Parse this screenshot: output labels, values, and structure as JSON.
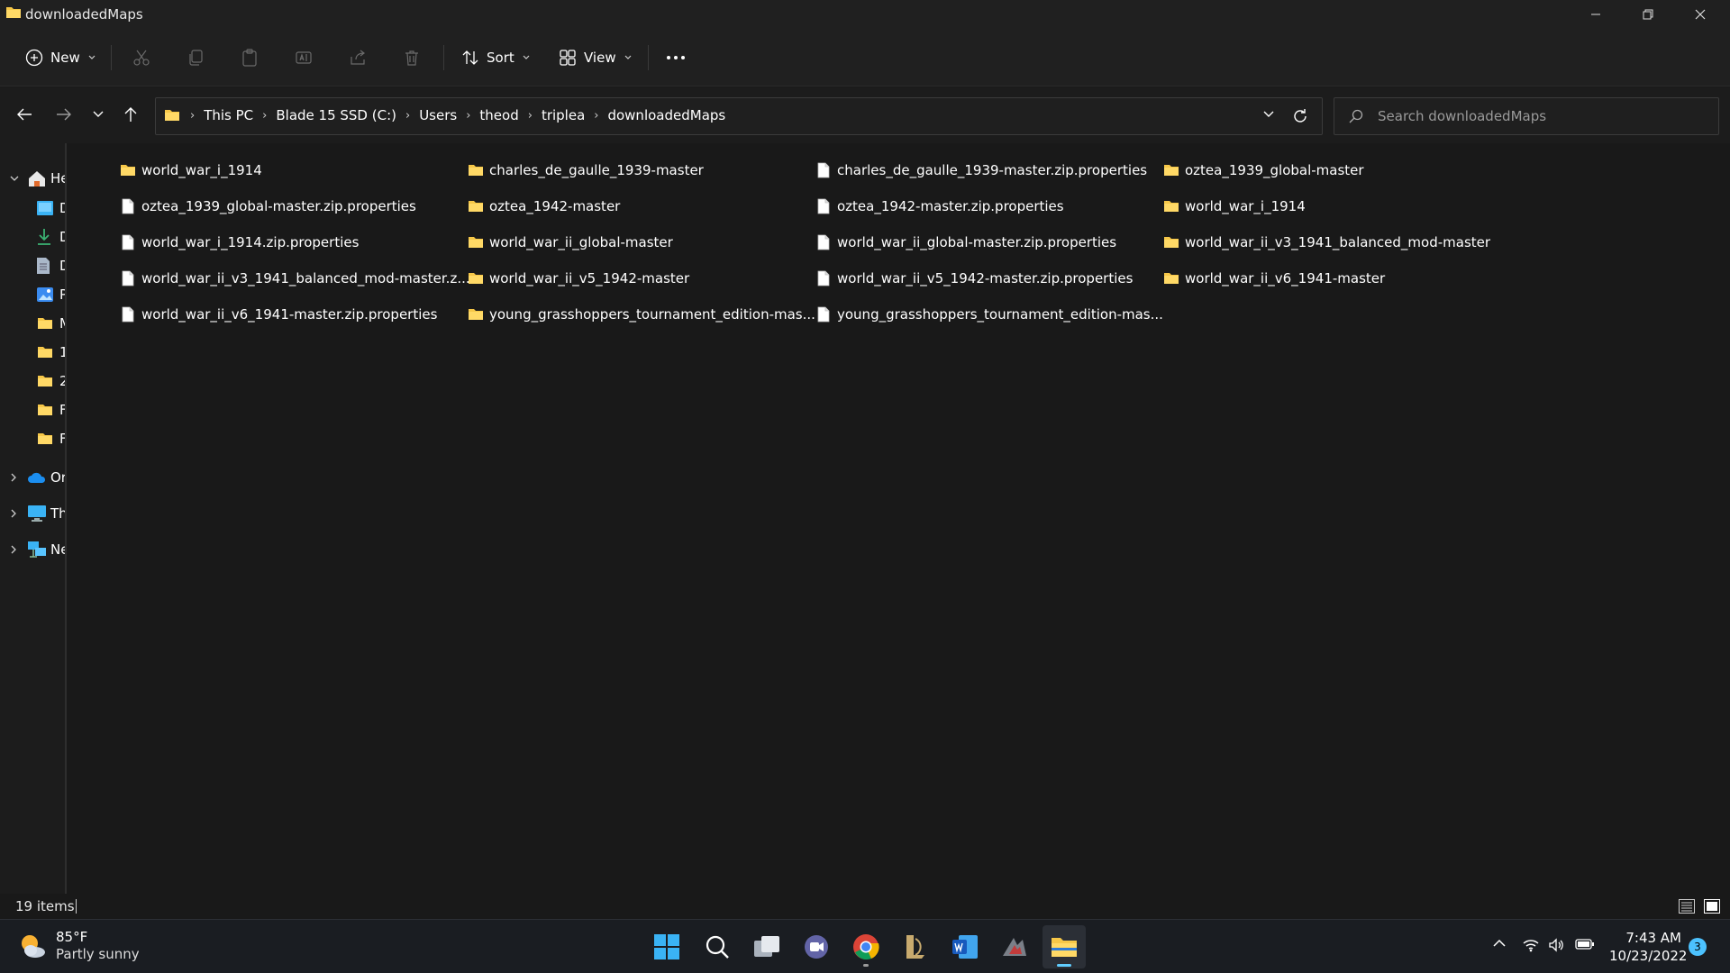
{
  "window": {
    "title": "downloadedMaps"
  },
  "toolbar": {
    "new_label": "New",
    "sort_label": "Sort",
    "view_label": "View"
  },
  "address": {
    "crumbs": [
      "This PC",
      "Blade 15 SSD (C:)",
      "Users",
      "theod",
      "triplea",
      "downloadedMaps"
    ]
  },
  "search": {
    "placeholder": "Search downloadedMaps"
  },
  "sidebar": {
    "items": [
      {
        "label": "Home",
        "visible": "He",
        "icon": "home-icon"
      },
      {
        "label": "Desktop",
        "visible": "D",
        "icon": "desktop-icon"
      },
      {
        "label": "Downloads",
        "visible": "D",
        "icon": "download-icon"
      },
      {
        "label": "Documents",
        "visible": "D",
        "icon": "document-icon"
      },
      {
        "label": "Pictures",
        "visible": "P",
        "icon": "pictures-icon"
      },
      {
        "label": "Music",
        "visible": "M",
        "icon": "folder-icon"
      },
      {
        "label": "1",
        "visible": "1",
        "icon": "folder-icon"
      },
      {
        "label": "2",
        "visible": "2",
        "icon": "folder-icon"
      },
      {
        "label": "F",
        "visible": "F",
        "icon": "folder-icon"
      },
      {
        "label": "F",
        "visible": "F",
        "icon": "folder-icon"
      },
      {
        "label": "OneDrive",
        "visible": "Or",
        "icon": "cloud-icon"
      },
      {
        "label": "This PC",
        "visible": "Th",
        "icon": "computer-icon"
      },
      {
        "label": "Network",
        "visible": "Ne",
        "icon": "network-icon"
      }
    ]
  },
  "files": [
    {
      "name": "world_war_i_1914",
      "type": "folder"
    },
    {
      "name": "oztea_1939_global-master.zip.properties",
      "type": "file"
    },
    {
      "name": "world_war_i_1914.zip.properties",
      "type": "file"
    },
    {
      "name": "world_war_ii_v3_1941_balanced_mod-master.z...",
      "type": "file"
    },
    {
      "name": "world_war_ii_v6_1941-master.zip.properties",
      "type": "file"
    },
    {
      "name": "charles_de_gaulle_1939-master",
      "type": "folder"
    },
    {
      "name": "oztea_1942-master",
      "type": "folder"
    },
    {
      "name": "world_war_ii_global-master",
      "type": "folder"
    },
    {
      "name": "world_war_ii_v5_1942-master",
      "type": "folder"
    },
    {
      "name": "young_grasshoppers_tournament_edition-mas...",
      "type": "folder"
    },
    {
      "name": "charles_de_gaulle_1939-master.zip.properties",
      "type": "file"
    },
    {
      "name": "oztea_1942-master.zip.properties",
      "type": "file"
    },
    {
      "name": "world_war_ii_global-master.zip.properties",
      "type": "file"
    },
    {
      "name": "world_war_ii_v5_1942-master.zip.properties",
      "type": "file"
    },
    {
      "name": "young_grasshoppers_tournament_edition-mas...",
      "type": "file"
    },
    {
      "name": "oztea_1939_global-master",
      "type": "folder"
    },
    {
      "name": "world_war_i_1914",
      "type": "folder"
    },
    {
      "name": "world_war_ii_v3_1941_balanced_mod-master",
      "type": "folder"
    },
    {
      "name": "world_war_ii_v6_1941-master",
      "type": "folder"
    }
  ],
  "status": {
    "item_count": "19 items"
  },
  "taskbar": {
    "weather_temp": "85°F",
    "weather_desc": "Partly sunny",
    "apps": [
      "start-icon",
      "search-icon",
      "task-view-icon",
      "teams-chat-icon",
      "chrome-icon",
      "league-icon",
      "word-icon",
      "game-icon",
      "file-explorer-icon"
    ],
    "time": "7:43 AM",
    "date": "10/23/2022",
    "notifications": "3"
  },
  "colors": {
    "folder": "#f6c748",
    "accent": "#60cdff",
    "background": "#191919"
  }
}
